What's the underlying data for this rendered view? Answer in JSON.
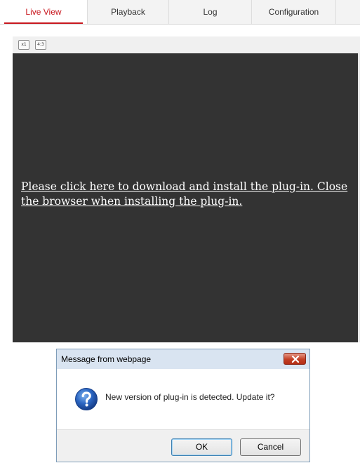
{
  "tabs": [
    {
      "label": "Live View",
      "active": true
    },
    {
      "label": "Playback",
      "active": false
    },
    {
      "label": "Log",
      "active": false
    },
    {
      "label": "Configuration",
      "active": false
    }
  ],
  "toolbar": {
    "scale_label": "x1",
    "ratio_label": "4:3"
  },
  "video": {
    "plugin_message": "Please click here to download and install the plug-in. Close the browser when installing the plug-in."
  },
  "dialog": {
    "title": "Message from webpage",
    "icon": "question-icon",
    "message": "New version of plug-in is detected. Update it?",
    "ok_label": "OK",
    "cancel_label": "Cancel"
  },
  "colors": {
    "accent": "#c8171e",
    "video_background": "#333333",
    "dialog_titlebar": "#d9e4f1",
    "close_button": "#c33f24",
    "question_icon": "#2b66c2"
  }
}
